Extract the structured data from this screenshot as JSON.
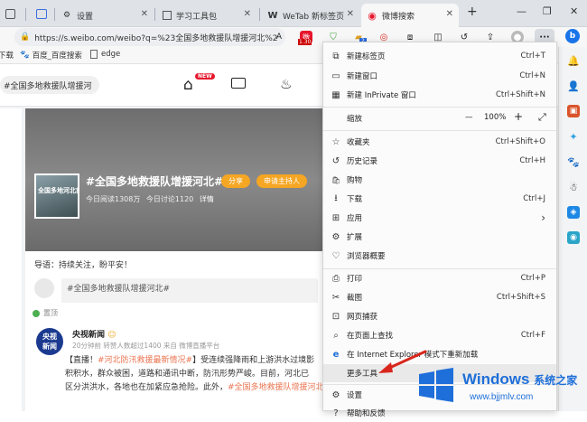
{
  "tabs": [
    {
      "label": "设置"
    },
    {
      "label": "学习工具包"
    },
    {
      "label": "WeTab 新标签页"
    },
    {
      "label": "微博搜索"
    }
  ],
  "new_tab": "+",
  "window_controls": {
    "minimize": "—",
    "restore": "❐",
    "close": "✕"
  },
  "address": {
    "url": "https://s.weibo.com/weibo?q=%23全国多地救援队增援河北%2"
  },
  "toolbar": {
    "badge1": "1.30",
    "badge2": "2",
    "more": "···"
  },
  "favorites": [
    {
      "label": "下载"
    },
    {
      "label": "百度_百度搜索"
    },
    {
      "label": "edge"
    }
  ],
  "site": {
    "search_value": "#全国多地救援队增援河",
    "new_badge": "NEW"
  },
  "topic": {
    "title": "#全国多地救援队增援河北#",
    "share": "分享",
    "host": "申请主持人",
    "stats_reads": "今日阅读1308万",
    "stats_discuss": "今日讨论1120",
    "detail": "详情",
    "intro": "导语：持续关注，盼平安！",
    "thumb": "全国多地河北救援",
    "compose": "#全国多地救援队增援河北#"
  },
  "post": {
    "top_label": "置顶",
    "avatar_line1": "央视",
    "avatar_line2": "新闻",
    "user": "央视新闻",
    "meta": "20分钟前 转赞人数超过1400  来自 微博直播平台",
    "line1_a": "【直播！",
    "line1_b": "#河北防汛救援最新情况#",
    "line1_c": "】受连续强降雨和上游洪水过境影",
    "line2": "积积水，群众被困，道路和通讯中断，防汛形势严峻。目前，河北已",
    "line3_a": "区分洪洪水，各地也在加紧应急抢险。此外，",
    "line3_b": "#全国多地救援队增援河北"
  },
  "menu": {
    "items": [
      {
        "icon": "⧉",
        "label": "新建标签页",
        "shortcut": "Ctrl+T"
      },
      {
        "icon": "▭",
        "label": "新建窗口",
        "shortcut": "Ctrl+N"
      },
      {
        "icon": "▦",
        "label": "新建 InPrivate 窗口",
        "shortcut": "Ctrl+Shift+N"
      },
      {
        "icon": "",
        "label": "缩放",
        "shortcut": ""
      },
      {
        "icon": "☆",
        "label": "收藏夹",
        "shortcut": "Ctrl+Shift+O"
      },
      {
        "icon": "↺",
        "label": "历史记录",
        "shortcut": "Ctrl+H"
      },
      {
        "icon": "🛍",
        "label": "购物",
        "shortcut": ""
      },
      {
        "icon": "⭳",
        "label": "下载",
        "shortcut": "Ctrl+J"
      },
      {
        "icon": "⊞",
        "label": "应用",
        "shortcut": "›"
      },
      {
        "icon": "⚙",
        "label": "扩展",
        "shortcut": ""
      },
      {
        "icon": "♡",
        "label": "浏览器概要",
        "shortcut": ""
      },
      {
        "icon": "⎙",
        "label": "打印",
        "shortcut": "Ctrl+P"
      },
      {
        "icon": "✂",
        "label": "截图",
        "shortcut": "Ctrl+Shift+S"
      },
      {
        "icon": "⊡",
        "label": "网页捕获",
        "shortcut": ""
      },
      {
        "icon": "⌕",
        "label": "在页面上查找",
        "shortcut": "Ctrl+F"
      },
      {
        "icon": "e",
        "label": "在 Internet Explorer 模式下重新加载",
        "shortcut": ""
      },
      {
        "icon": "",
        "label": "更多工具",
        "shortcut": ""
      },
      {
        "icon": "⚙",
        "label": "设置",
        "shortcut": ""
      },
      {
        "icon": "?",
        "label": "帮助和反馈",
        "shortcut": ""
      }
    ],
    "zoom_value": "100%",
    "zoom_minus": "—",
    "zoom_plus": "+",
    "zoom_full": "⤢"
  },
  "watermark": {
    "brand": "Windows",
    "cn": "系统之家",
    "url": "www.bjjmlv.com"
  },
  "colors": {
    "accent_orange": "#f5a623",
    "weibo_red": "#e6162d",
    "link_orange": "#eb7350",
    "arrow_red": "#d9261c",
    "windows_blue": "#1e6fd9"
  }
}
